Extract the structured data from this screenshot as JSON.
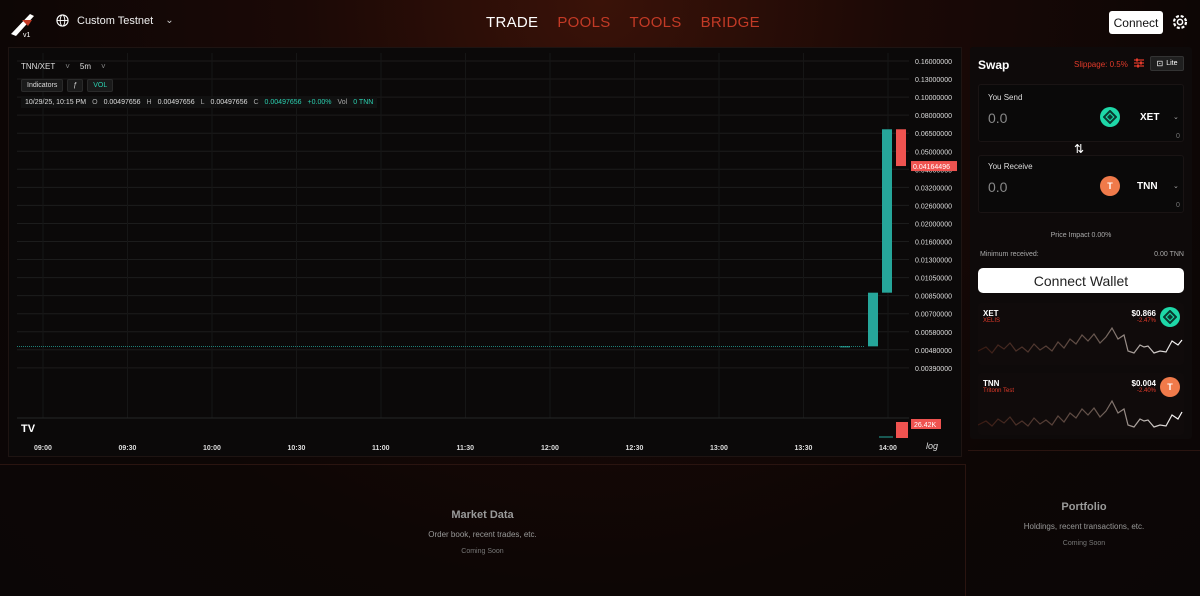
{
  "header": {
    "network_label": "Custom Testnet",
    "nav": [
      {
        "label": "TRADE",
        "active": true
      },
      {
        "label": "POOLS",
        "active": false
      },
      {
        "label": "TOOLS",
        "active": false
      },
      {
        "label": "BRIDGE",
        "active": false
      }
    ],
    "connect_label": "Connect",
    "logo_text": "v1"
  },
  "chart": {
    "pair": "TNN/XET",
    "interval": "5m",
    "toolbar": [
      "Indicators",
      "ƒ",
      "VOL"
    ],
    "ohlc": {
      "date": "10/29/25, 10:15 PM",
      "o_label": "O",
      "o": "0.00497656",
      "h_label": "H",
      "h": "0.00497656",
      "l_label": "L",
      "l": "0.00497656",
      "c_label": "C",
      "c": "0.00497656",
      "change": "+0.00%",
      "vol_label": "Vol",
      "vol": "0 TNN"
    },
    "price_ticks": [
      "0.16000000",
      "0.13000000",
      "0.10000000",
      "0.08000000",
      "0.06500000",
      "0.05000000",
      "0.04000000",
      "0.03200000",
      "0.02600000",
      "0.02000000",
      "0.01600000",
      "0.01300000",
      "0.01050000",
      "0.00850000",
      "0.00700000",
      "0.00580000",
      "0.00480000",
      "0.00390000"
    ],
    "last_price_label": "0.04164496",
    "volume_label": "26.42K",
    "time_ticks": [
      "09:00",
      "09:30",
      "10:00",
      "10:30",
      "11:00",
      "11:30",
      "12:00",
      "12:30",
      "13:00",
      "13:30",
      "14:00"
    ],
    "log_label": "log",
    "tv_logo": "TV"
  },
  "chart_data": {
    "type": "candlestick",
    "title": "TNN/XET",
    "interval": "5m",
    "scale": "log",
    "candles": [
      {
        "time": "13:50",
        "open": 0.00497656,
        "close": 0.00497656,
        "color": "green"
      },
      {
        "time": "13:55",
        "open": 0.00497656,
        "close": 0.0088,
        "color": "green"
      },
      {
        "time": "14:00",
        "open": 0.0088,
        "close": 0.068,
        "color": "green"
      },
      {
        "time": "14:05",
        "open": 0.068,
        "close": 0.04164496,
        "color": "red"
      }
    ],
    "last_price": 0.04164496,
    "last_volume": "26.42K"
  },
  "swap": {
    "title": "Swap",
    "slippage": "Slippage: 0.5%",
    "lite_label": "Lite",
    "send": {
      "label": "You Send",
      "amount": "0.0",
      "token": "XET",
      "balance": "0"
    },
    "receive": {
      "label": "You Receive",
      "amount": "0.0",
      "token": "TNN",
      "token_letter": "T",
      "balance": "0"
    },
    "price_impact": "Price Impact 0.00%",
    "min_received_label": "Minimum received:",
    "min_received_value": "0.00 TNN",
    "wallet_button": "Connect Wallet"
  },
  "token_cards": [
    {
      "symbol": "XET",
      "name": "XELIS",
      "price": "$0.866",
      "change": "-2.47%",
      "icon": "xet-icon"
    },
    {
      "symbol": "TNN",
      "name": "Tritonn Test",
      "price": "$0.004",
      "change": "-2.40%",
      "icon": "tnn-icon",
      "letter": "T"
    }
  ],
  "market": {
    "title": "Market Data",
    "subtitle": "Order book, recent trades, etc.",
    "soon": "Coming Soon"
  },
  "portfolio": {
    "title": "Portfolio",
    "subtitle": "Holdings, recent transactions, etc.",
    "soon": "Coming Soon"
  },
  "colors": {
    "up": "#26a69a",
    "down": "#ef5350",
    "accent": "#c33a26",
    "xet": "#1ed8a8",
    "tnn": "#f07a4a"
  }
}
